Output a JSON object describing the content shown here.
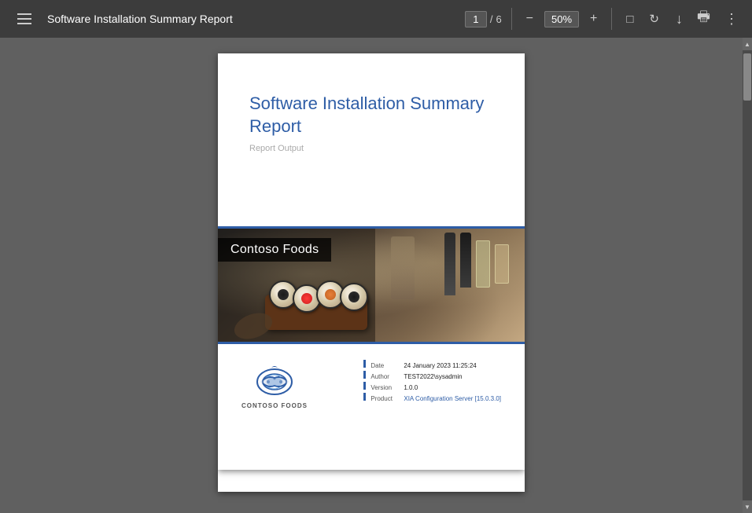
{
  "toolbar": {
    "menu_label": "Menu",
    "title": "Software Installation Summary Report",
    "page_current": "1",
    "page_separator": "/",
    "page_total": "6",
    "zoom_out_label": "−",
    "zoom_value": "50%",
    "zoom_in_label": "+",
    "fit_icon_label": "fit-page-icon",
    "history_icon_label": "history-icon",
    "download_label": "download-icon",
    "print_label": "print-icon",
    "more_label": "more-options-icon"
  },
  "page1": {
    "report_title": "Software Installation Summary Report",
    "report_subtitle": "Report Output",
    "banner_company": "Contoso Foods",
    "logo_company": "CONTOSO FOODS",
    "info": {
      "date_label": "Date",
      "date_value": "24 January 2023 11:25:24",
      "author_label": "Author",
      "author_value": "TEST2022\\sysadmin",
      "version_label": "Version",
      "version_value": "1.0.0",
      "product_label": "Product",
      "product_value": "XIA Configuration Server [15.0.3.0]"
    }
  },
  "scrollbar": {
    "up_arrow": "▲",
    "down_arrow": "▼"
  }
}
